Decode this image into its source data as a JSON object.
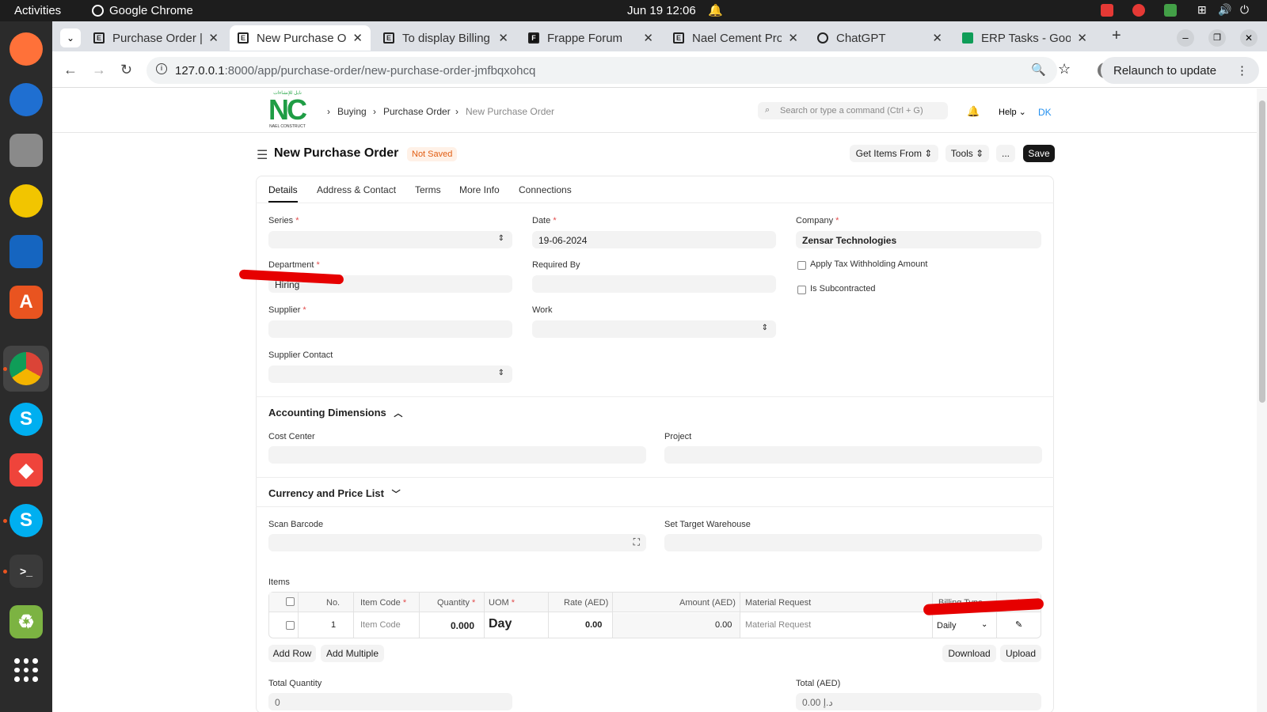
{
  "topbar": {
    "activities": "Activities",
    "app": "Google Chrome",
    "datetime": "Jun 19  12:06"
  },
  "tabs": [
    {
      "title": "Purchase Order |"
    },
    {
      "title": "New Purchase Order"
    },
    {
      "title": "To display Billing"
    },
    {
      "title": "Frappe Forum"
    },
    {
      "title": "Nael Cement Pro"
    },
    {
      "title": "ChatGPT"
    },
    {
      "title": "ERP Tasks - Goog"
    }
  ],
  "url": "127.0.0.1:8000/app/purchase-order/new-purchase-order-jmfbqxohcq",
  "url_host": "127.0.0.1",
  "url_rest": ":8000/app/purchase-order/new-purchase-order-jmfbqxohcq",
  "relaunch": "Relaunch to update",
  "logo": {
    "text": "NC",
    "arabic": "نايل للإنشاءات",
    "sub": "NAEL CONSTRUCT"
  },
  "breadcrumb": [
    "Buying",
    "Purchase Order",
    "New Purchase Order"
  ],
  "search_placeholder": "Search or type a command (Ctrl + G)",
  "help": "Help",
  "avatar": "DK",
  "page": {
    "title": "New Purchase Order",
    "status": "Not Saved"
  },
  "actions": {
    "get_items": "Get Items From",
    "tools": "Tools",
    "more": "...",
    "save": "Save"
  },
  "form_tabs": [
    "Details",
    "Address & Contact",
    "Terms",
    "More Info",
    "Connections"
  ],
  "fields": {
    "series": {
      "label": "Series",
      "value": ""
    },
    "date": {
      "label": "Date",
      "value": "19-06-2024"
    },
    "company": {
      "label": "Company",
      "value": "Zensar Technologies"
    },
    "department": {
      "label": "Department",
      "value": "Hiring"
    },
    "required_by": {
      "label": "Required By",
      "value": ""
    },
    "apply_tax": {
      "label": "Apply Tax Withholding Amount"
    },
    "is_subcontracted": {
      "label": "Is Subcontracted"
    },
    "supplier": {
      "label": "Supplier",
      "value": ""
    },
    "work": {
      "label": "Work",
      "value": ""
    },
    "supplier_contact": {
      "label": "Supplier Contact",
      "value": ""
    }
  },
  "accounting": {
    "title": "Accounting Dimensions",
    "cost_center": "Cost Center",
    "project": "Project"
  },
  "currency": {
    "title": "Currency and Price List"
  },
  "scan_barcode": "Scan Barcode",
  "set_target_warehouse": "Set Target Warehouse",
  "items": {
    "label": "Items",
    "headers": [
      "No.",
      "Item Code",
      "Quantity",
      "UOM",
      "Rate (AED)",
      "Amount (AED)",
      "Material Request",
      "Billing Type"
    ],
    "row": {
      "no": "1",
      "item_code": "Item Code",
      "quantity": "0.000",
      "uom": "Day",
      "rate": "0.00",
      "amount": "0.00",
      "material_request": "Material Request",
      "billing_type": "Daily"
    },
    "add_row": "Add Row",
    "add_multiple": "Add Multiple",
    "download": "Download",
    "upload": "Upload"
  },
  "totals": {
    "qty_label": "Total Quantity",
    "qty_value": "0",
    "total_label": "Total (AED)",
    "total_value": "0.00 د.إ"
  }
}
